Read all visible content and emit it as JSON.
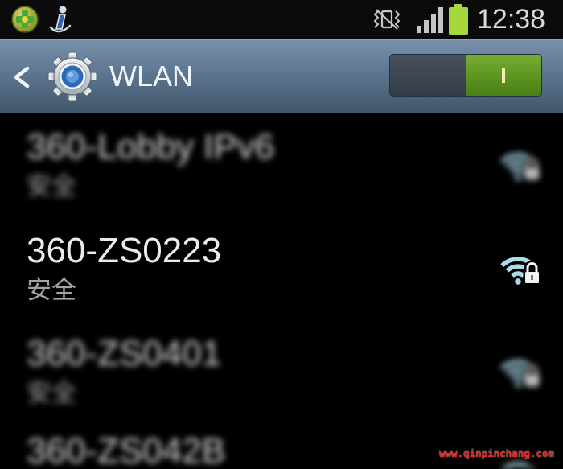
{
  "status_bar": {
    "icons": {
      "left": [
        "360-security-icon",
        "notification-figure-icon"
      ],
      "right": [
        "vibrate-mute-icon",
        "signal-strength-icon",
        "battery-icon"
      ]
    },
    "signal_bars_filled": 4,
    "battery_level": 1.0,
    "time": "12:38"
  },
  "action_bar": {
    "back_icon": "chevron-left-icon",
    "app_icon": "settings-gear-icon",
    "title": "WLAN",
    "wlan_toggle": {
      "on": true,
      "on_label": "I"
    }
  },
  "networks": [
    {
      "ssid": "360-Lobby IPv6",
      "security": "安全",
      "icon": "wifi-secured-icon",
      "blurred": true
    },
    {
      "ssid": "360-ZS0223",
      "security": "安全",
      "icon": "wifi-secured-icon",
      "blurred": false
    },
    {
      "ssid": "360-ZS0401",
      "security": "安全",
      "icon": "wifi-secured-icon",
      "blurred": true
    },
    {
      "ssid": "360-ZS042B",
      "icon": "wifi-secured-icon",
      "blurred": true
    }
  ],
  "watermark": "www.qinpinchang.com",
  "colors": {
    "status_bar_bg": "#0b0b0b",
    "action_bar_top": "#7891ab",
    "action_bar_bottom": "#415669",
    "toggle_on": "#5f9622",
    "toggle_off": "#394350",
    "battery": "#a6d83b",
    "wifi_icon": "#a9dbea",
    "list_bg": "#000000",
    "watermark": "#e3221c"
  }
}
